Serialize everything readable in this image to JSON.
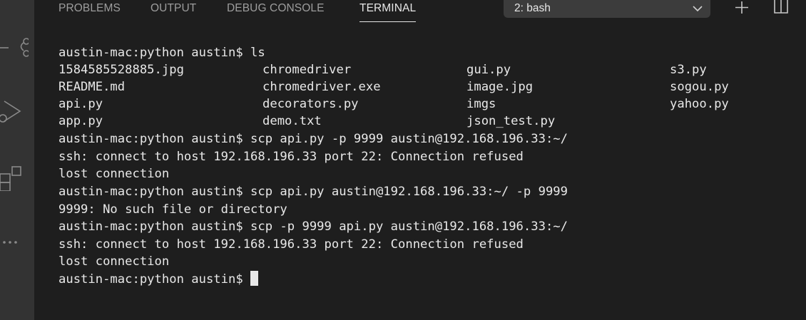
{
  "panel": {
    "tabs": [
      {
        "label": "PROBLEMS",
        "active": false
      },
      {
        "label": "OUTPUT",
        "active": false
      },
      {
        "label": "DEBUG CONSOLE",
        "active": false
      },
      {
        "label": "TERMINAL",
        "active": true
      }
    ],
    "terminal_select": {
      "value": "2: bash"
    }
  },
  "activity_bar": {
    "icons": [
      "source-control-icon",
      "run-debug-icon",
      "extensions-icon",
      "more-icon"
    ]
  },
  "terminal": {
    "lines": [
      "austin-mac:python austin$ ls",
      "",
      "",
      "",
      "",
      "austin-mac:python austin$ scp api.py -p 9999 austin@192.168.196.33:~/",
      "ssh: connect to host 192.168.196.33 port 22: Connection refused",
      "lost connection",
      "austin-mac:python austin$ scp api.py austin@192.168.196.33:~/ -p 9999",
      "9999: No such file or directory",
      "austin-mac:python austin$ scp -p 9999 api.py austin@192.168.196.33:~/",
      "ssh: connect to host 192.168.196.33 port 22: Connection refused",
      "lost connection",
      "austin-mac:python austin$ "
    ],
    "ls_output": [
      [
        "1584585528885.jpg",
        "chromedriver",
        "gui.py",
        "s3.py"
      ],
      [
        "README.md",
        "chromedriver.exe",
        "image.jpg",
        "sogou.py"
      ],
      [
        "api.py",
        "decorators.py",
        "imgs",
        "yahoo.py"
      ],
      [
        "app.py",
        "demo.txt",
        "json_test.py",
        ""
      ]
    ]
  },
  "colors": {
    "background": "#1e1e1e",
    "activity_bar": "#333333",
    "text": "#e8e8e8",
    "tab_inactive": "#9d9d9d",
    "select_bg": "#3c3c3c"
  }
}
